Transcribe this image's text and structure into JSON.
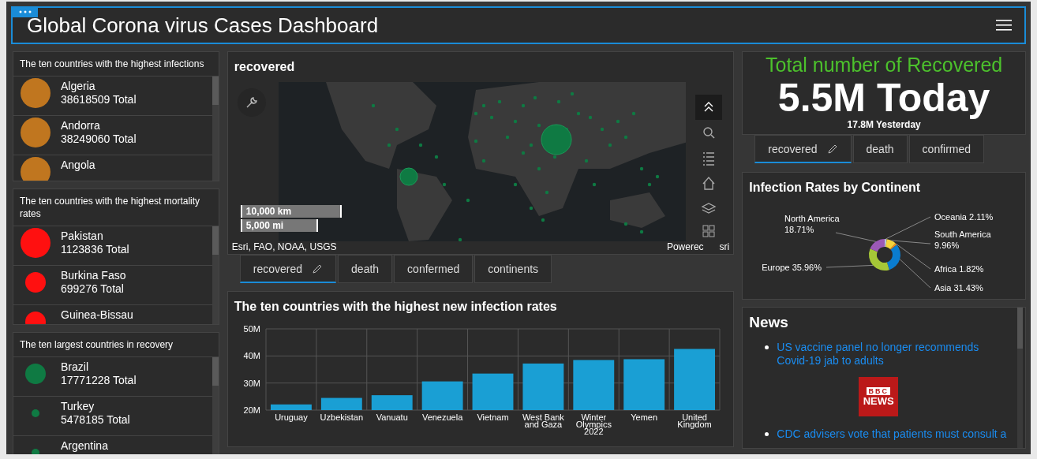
{
  "header": {
    "title": "Global Corona virus Cases Dashboard"
  },
  "list_panels": [
    {
      "title": "The ten countries with the highest infections",
      "color": "#c0761f",
      "items": [
        {
          "name": "Algeria",
          "total": "38618509 Total",
          "kind": "large"
        },
        {
          "name": "Andorra",
          "total": "38249060 Total",
          "kind": "large"
        },
        {
          "name": "Angola",
          "kind": "large"
        }
      ]
    },
    {
      "title": "The ten countries with the highest mortality rates",
      "color": "#ff1010",
      "items": [
        {
          "name": "Pakistan",
          "total": "1123836 Total",
          "kind": "large"
        },
        {
          "name": "Burkina Faso",
          "total": "699276 Total",
          "kind": "medium"
        },
        {
          "name": "Guinea-Bissau",
          "kind": "medium"
        }
      ]
    },
    {
      "title": "The ten largest countries in recovery",
      "color": "#0f7a43",
      "items": [
        {
          "name": "Brazil",
          "total": "17771228 Total",
          "kind": "medium"
        },
        {
          "name": "Turkey",
          "total": "5478185 Total",
          "kind": "small"
        },
        {
          "name": "Argentina",
          "kind": "small"
        }
      ]
    }
  ],
  "map": {
    "title": "recovered",
    "scale_km": "10,000 km",
    "scale_mi": "5,000 mi",
    "attribution": "Esri, FAO, NOAA, USGS",
    "powered_left": "Powerec",
    "powered_right": "sri"
  },
  "map_tabs": [
    {
      "label": "recovered",
      "selected": true
    },
    {
      "label": "death",
      "selected": false
    },
    {
      "label": "confermed",
      "selected": false
    },
    {
      "label": "continents",
      "selected": false
    }
  ],
  "bar_panel": {
    "title": "The ten countries with the highest new infection rates",
    "chart_data": {
      "type": "bar",
      "categories": [
        "Uruguay",
        "Uzbekistan",
        "Vanuatu",
        "Venezuela",
        "Vietnam",
        "West Bank and Gaza",
        "Winter Olympics 2022",
        "Yemen",
        "United Kingdom"
      ],
      "values": [
        22.1,
        24.5,
        25.5,
        30.6,
        33.5,
        37.2,
        38.5,
        38.8,
        42.6
      ],
      "ylim": [
        20,
        50
      ],
      "yticks": [
        {
          "value": 20,
          "label": "20M"
        },
        {
          "value": 30,
          "label": "30M"
        },
        {
          "value": 40,
          "label": "40M"
        },
        {
          "value": 50,
          "label": "50M"
        }
      ]
    }
  },
  "kpi": {
    "title": "Total number of Recovered",
    "value": "5.5M Today",
    "reference": "17.8M Yesterday"
  },
  "kpi_tabs": [
    {
      "label": "recovered",
      "selected": true
    },
    {
      "label": "death",
      "selected": false
    },
    {
      "label": "confirmed",
      "selected": false
    }
  ],
  "donut_panel": {
    "title": "Infection Rates by Continent",
    "chart_data": {
      "type": "donut",
      "categories": [
        "Oceania",
        "South America",
        "Africa",
        "Asia",
        "Europe",
        "North America"
      ],
      "values": [
        2.11,
        9.96,
        1.82,
        31.43,
        35.96,
        18.71
      ],
      "value_labels": [
        "2.11%",
        "9.96%",
        "1.82%",
        "31.43%",
        "35.96%",
        "18.71%"
      ],
      "colors": [
        "#b9c7d6",
        "#f5d33c",
        "#f08c1e",
        "#0a7ccf",
        "#a6c837",
        "#9b59b6"
      ]
    }
  },
  "news": {
    "title": "News",
    "items": [
      {
        "text": "US vaccine panel no longer recommends Covid-19 jab to adults"
      },
      {
        "text": "CDC advisers vote that patients must consult a"
      }
    ],
    "logo_top": "BBC",
    "logo_bottom": "NEWS"
  }
}
